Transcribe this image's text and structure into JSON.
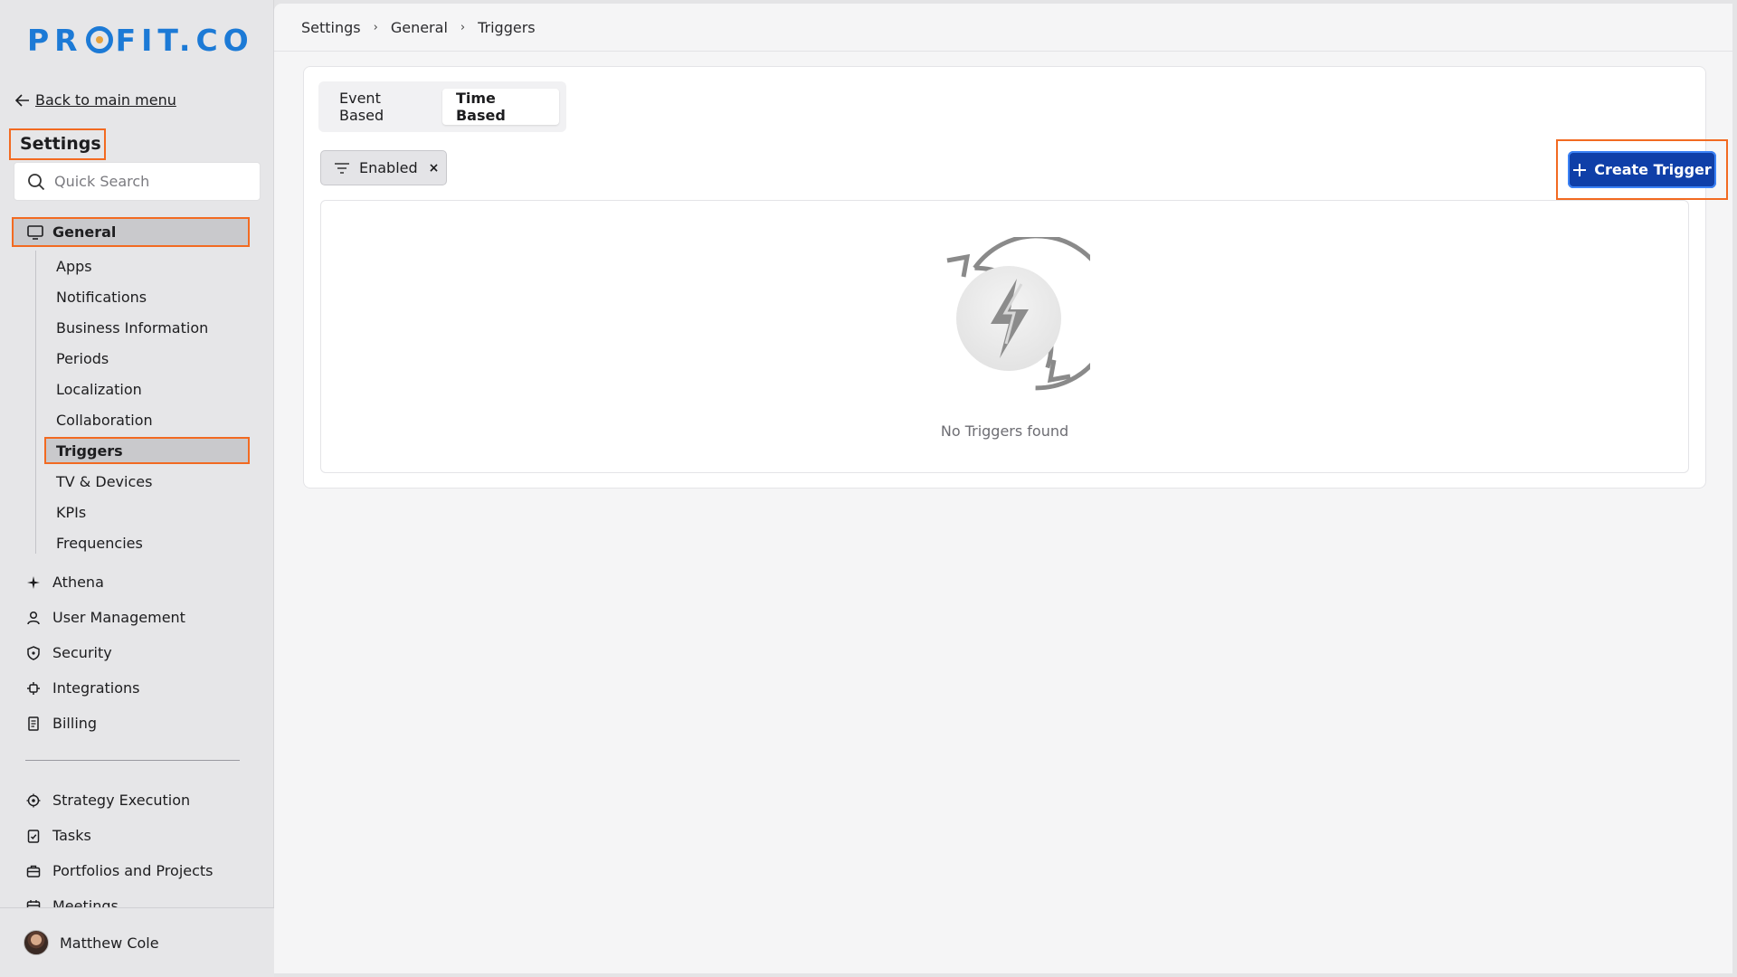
{
  "brand": {
    "logo_text_left": "PR",
    "logo_text_right": "FIT.CO"
  },
  "sidebar": {
    "back_label": "Back to main menu",
    "title": "Settings",
    "search": {
      "placeholder": "Quick Search",
      "value": ""
    },
    "general_label": "General",
    "general_items": [
      {
        "label": "Apps",
        "icon": "none"
      },
      {
        "label": "Notifications"
      },
      {
        "label": "Business Information"
      },
      {
        "label": "Periods"
      },
      {
        "label": "Localization"
      },
      {
        "label": "Collaboration"
      },
      {
        "label": "Triggers",
        "active": true
      },
      {
        "label": "TV & Devices"
      },
      {
        "label": "KPIs"
      },
      {
        "label": "Frequencies"
      }
    ],
    "main_items": [
      {
        "label": "Athena",
        "icon": "sparkle-icon"
      },
      {
        "label": "User Management",
        "icon": "user-icon"
      },
      {
        "label": "Security",
        "icon": "shield-icon"
      },
      {
        "label": "Integrations",
        "icon": "integration-icon"
      },
      {
        "label": "Billing",
        "icon": "billing-icon"
      }
    ],
    "secondary_items": [
      {
        "label": "Strategy Execution",
        "icon": "target-icon"
      },
      {
        "label": "Tasks",
        "icon": "task-icon"
      },
      {
        "label": "Portfolios and Projects",
        "icon": "briefcase-icon"
      },
      {
        "label": "Meetings",
        "icon": "calendar-icon"
      }
    ],
    "user": {
      "name": "Matthew Cole"
    }
  },
  "breadcrumb": [
    "Settings",
    "General",
    "Triggers"
  ],
  "tabs": [
    {
      "label": "Event Based",
      "selected": false
    },
    {
      "label": "Time Based",
      "selected": true
    }
  ],
  "filter": {
    "label": "Enabled",
    "remove": "×"
  },
  "create_button": {
    "label": "Create Trigger",
    "color": "#0f3fa8"
  },
  "empty_state": {
    "text": "No Triggers found"
  },
  "colors": {
    "accent": "#1c7ad6",
    "highlight": "#f26a21"
  }
}
